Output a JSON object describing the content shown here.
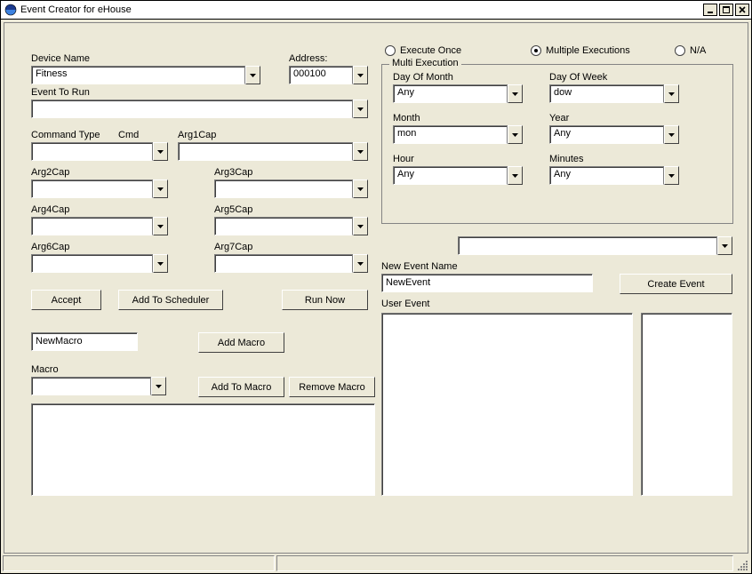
{
  "window": {
    "title": "Event Creator for eHouse"
  },
  "labels": {
    "device_name": "Device Name",
    "address": "Address:",
    "event_to_run": "Event To Run",
    "command_type": "Command Type",
    "cmd": "Cmd",
    "arg1": "Arg1Cap",
    "arg2": "Arg2Cap",
    "arg3": "Arg3Cap",
    "arg4": "Arg4Cap",
    "arg5": "Arg5Cap",
    "arg6": "Arg6Cap",
    "arg7": "Arg7Cap",
    "macro": "Macro",
    "new_event_name": "New Event Name",
    "user_event": "User Event"
  },
  "fields": {
    "device_name": "Fitness",
    "address": "000100",
    "event_to_run": "",
    "command_type": "",
    "arg1": "",
    "arg2": "",
    "arg3": "",
    "arg4": "",
    "arg5": "",
    "arg6": "",
    "arg7": "",
    "new_macro": "NewMacro",
    "macro": "",
    "extra_combo": "",
    "new_event_name": "NewEvent"
  },
  "buttons": {
    "accept": "Accept",
    "add_to_scheduler": "Add To Scheduler",
    "run_now": "Run Now",
    "add_macro": "Add Macro",
    "add_to_macro": "Add To Macro",
    "remove_macro": "Remove Macro",
    "create_event": "Create Event"
  },
  "radios": {
    "execute_once": "Execute Once",
    "multiple_exec": "Multiple Executions",
    "na": "N/A",
    "selected": "multiple_exec"
  },
  "multi": {
    "legend": "Multi Execution",
    "labels": {
      "day_of_month": "Day Of Month",
      "day_of_week": "Day Of Week",
      "month": "Month",
      "year": "Year",
      "hour": "Hour",
      "minutes": "Minutes"
    },
    "values": {
      "day_of_month": "Any",
      "day_of_week": "dow",
      "month": "mon",
      "year": "Any",
      "hour": "Any",
      "minutes": "Any"
    }
  }
}
